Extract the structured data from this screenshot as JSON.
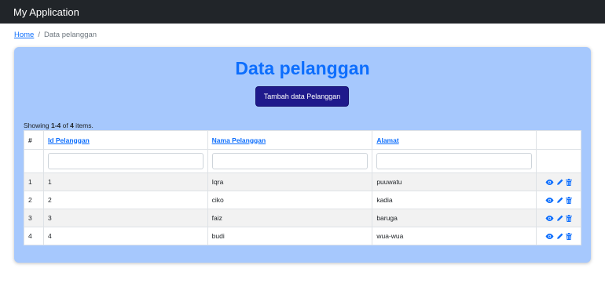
{
  "navbar": {
    "brand": "My Application"
  },
  "breadcrumb": {
    "home": "Home",
    "separator": "/",
    "current": "Data pelanggan"
  },
  "page": {
    "title": "Data pelanggan",
    "add_button": "Tambah data Pelanggan"
  },
  "summary": {
    "prefix": "Showing ",
    "range": "1-4",
    "middle": " of ",
    "total": "4",
    "suffix": " items."
  },
  "table": {
    "headers": {
      "num": "#",
      "id": "Id Pelanggan",
      "nama": "Nama Pelanggan",
      "alamat": "Alamat"
    },
    "rows": [
      {
        "num": "1",
        "id": "1",
        "nama": "Iqra",
        "alamat": "puuwatu"
      },
      {
        "num": "2",
        "id": "2",
        "nama": "ciko",
        "alamat": "kadia"
      },
      {
        "num": "3",
        "id": "3",
        "nama": "faiz",
        "alamat": "baruga"
      },
      {
        "num": "4",
        "id": "4",
        "nama": "budi",
        "alamat": "wua-wua"
      }
    ],
    "action_icons": [
      "eye-icon",
      "pencil-icon",
      "trash-icon"
    ]
  },
  "colors": {
    "navbar": "#212529",
    "card": "#a6c8fd",
    "title": "#0d6efd",
    "button": "#1f1a8c",
    "link": "#0d6efd"
  }
}
